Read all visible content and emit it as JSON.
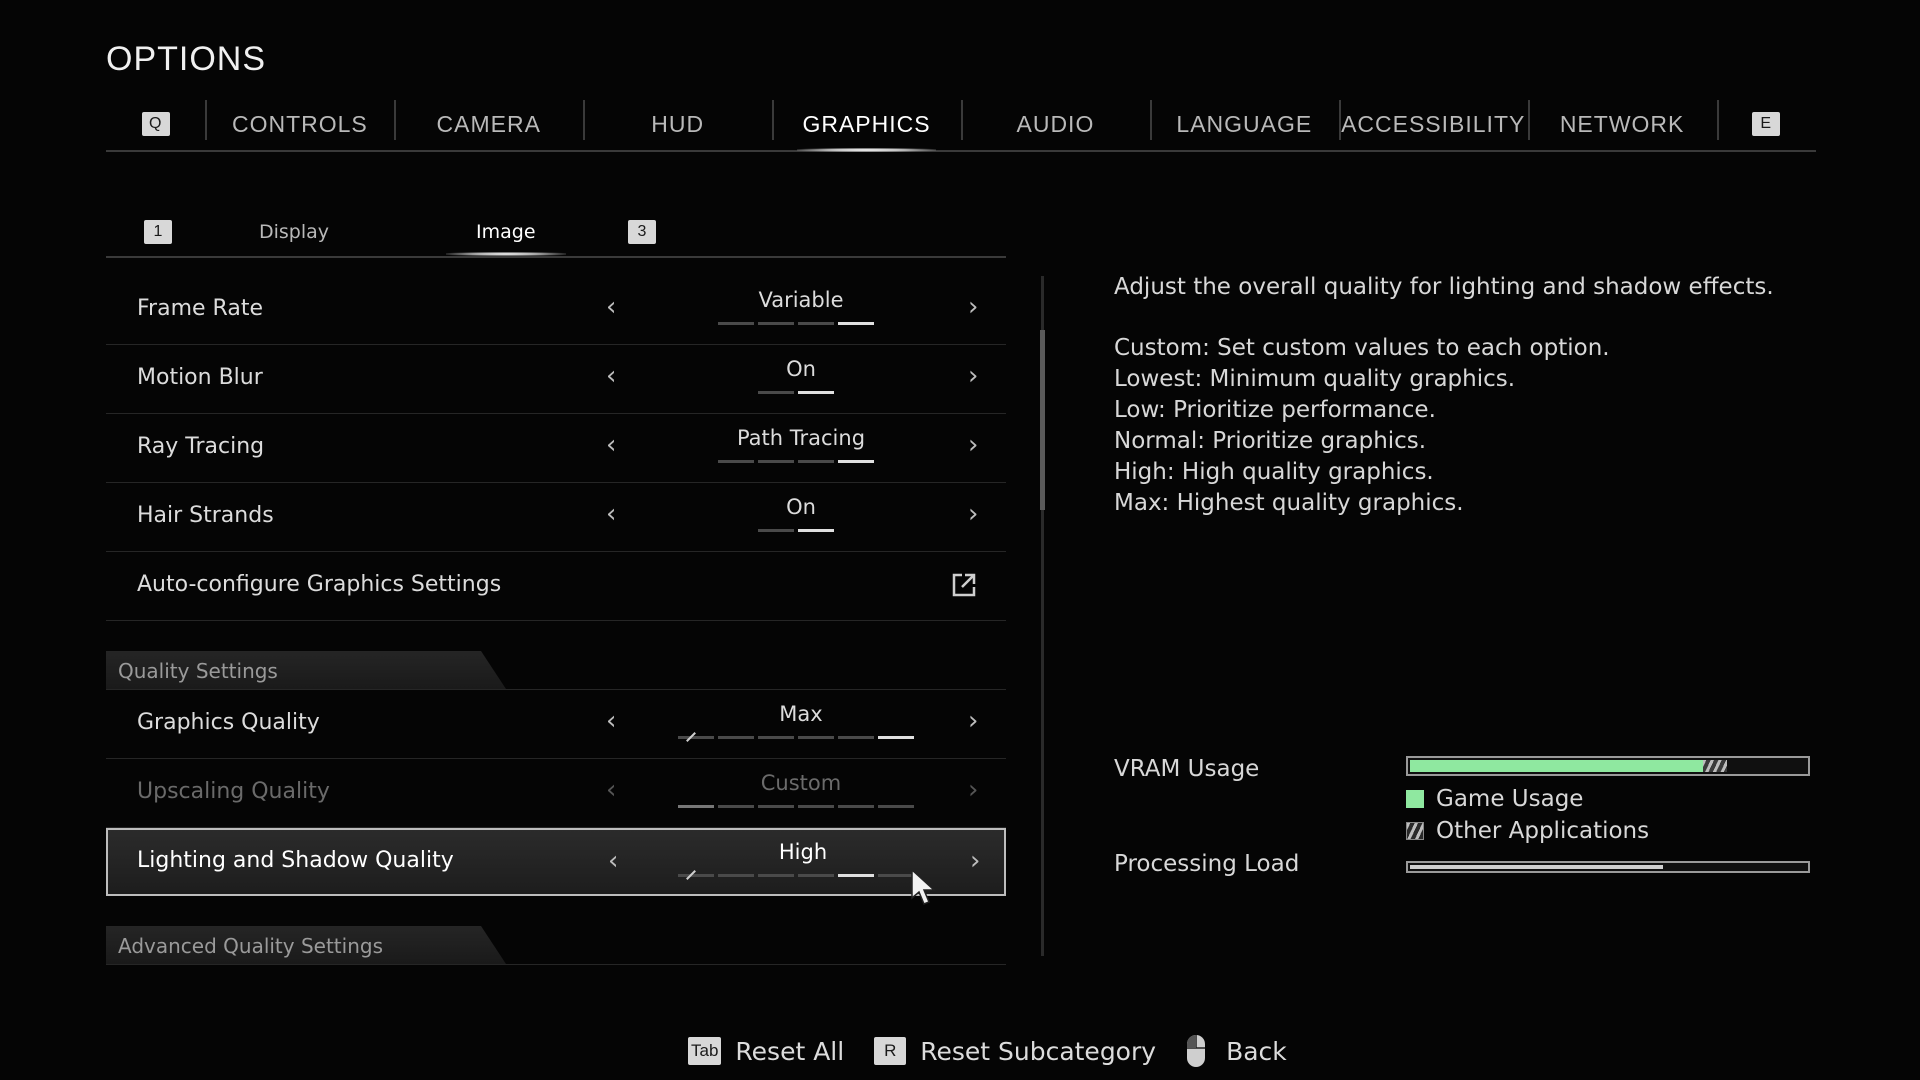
{
  "header": {
    "title": "OPTIONS"
  },
  "main_tabs": {
    "left_key": "Q",
    "right_key": "E",
    "items": [
      "CONTROLS",
      "CAMERA",
      "HUD",
      "GRAPHICS",
      "AUDIO",
      "LANGUAGE",
      "ACCESSIBILITY",
      "NETWORK"
    ],
    "active": "GRAPHICS"
  },
  "sub_tabs": {
    "left_key": "1",
    "right_key": "3",
    "items": [
      "Display",
      "Image"
    ],
    "active": "Image"
  },
  "settings": {
    "frame_rate": {
      "label": "Frame Rate",
      "value": "Variable"
    },
    "motion_blur": {
      "label": "Motion Blur",
      "value": "On"
    },
    "ray_tracing": {
      "label": "Ray Tracing",
      "value": "Path Tracing"
    },
    "hair_strands": {
      "label": "Hair Strands",
      "value": "On"
    },
    "auto_configure": {
      "label": "Auto-configure Graphics Settings"
    },
    "quality_section": "Quality Settings",
    "graphics_quality": {
      "label": "Graphics Quality",
      "value": "Max"
    },
    "upscaling_quality": {
      "label": "Upscaling Quality",
      "value": "Custom"
    },
    "lighting_shadow_quality": {
      "label": "Lighting and Shadow Quality",
      "value": "High"
    },
    "advanced_section": "Advanced Quality Settings"
  },
  "description": {
    "summary": "Adjust the overall quality for lighting and shadow effects.",
    "lines": [
      "Custom: Set custom values to each option.",
      "Lowest: Minimum quality graphics.",
      "Low: Prioritize performance.",
      "Normal: Prioritize graphics.",
      "High: High quality graphics.",
      "Max: Highest quality graphics."
    ]
  },
  "usage": {
    "vram_label": "VRAM Usage",
    "vram_game_fraction": 0.74,
    "vram_other_fraction": 0.06,
    "legend_game": "Game Usage",
    "legend_other": "Other Applications",
    "processing_label": "Processing Load",
    "processing_fraction": 0.64,
    "game_color": "#8fe8a0"
  },
  "footer": {
    "reset_all_key": "Tab",
    "reset_all": "Reset All",
    "reset_sub_key": "R",
    "reset_sub": "Reset Subcategory",
    "back": "Back"
  }
}
